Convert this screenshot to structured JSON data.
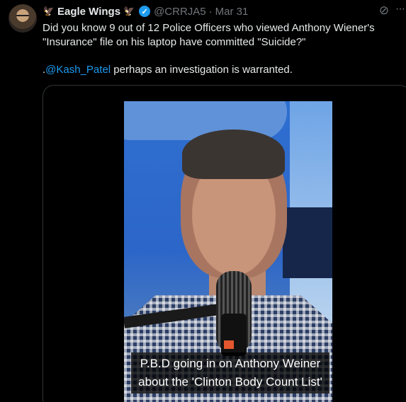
{
  "tweet": {
    "display_name": "Eagle Wings",
    "name_emoji": "🦅",
    "handle": "@CRRJA5",
    "separator": "·",
    "date": "Mar 31",
    "verified": true,
    "text_line1": "Did you know 9 out of 12 Police Officers who viewed Anthony Wiener's",
    "text_line2": "\"Insurance\" file on his laptop have committed \"Suicide?\"",
    "text_prefix": ".",
    "mention": "@Kash_Patel",
    "text_after_mention": " perhaps an investigation is warranted."
  },
  "media": {
    "caption_line1": "P.B.D going in on Anthony Weiner",
    "caption_line2": "about the 'Clinton Body Count List'"
  },
  "icons": {
    "grok": "grok-icon",
    "more": "more-icon",
    "verified": "verified-badge-icon"
  },
  "colors": {
    "background": "#000000",
    "text": "#e7e9ea",
    "secondary": "#71767b",
    "link": "#1d9bf0"
  }
}
